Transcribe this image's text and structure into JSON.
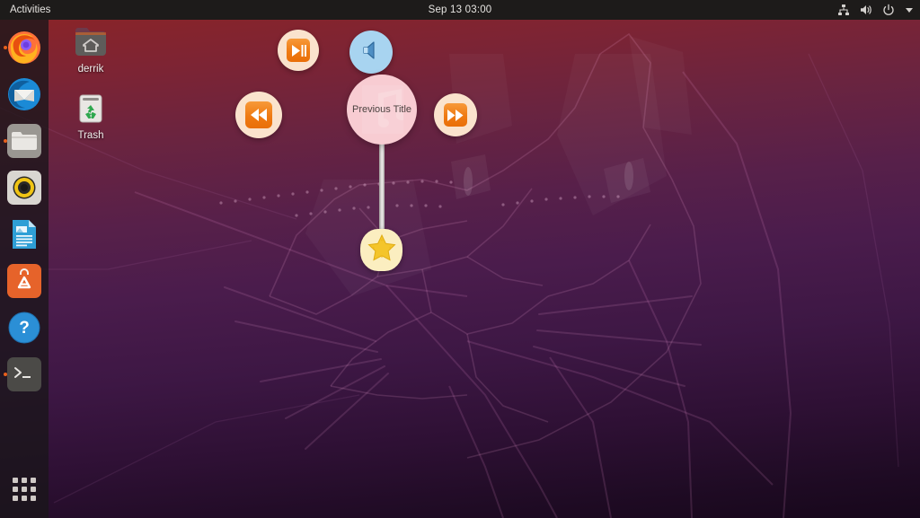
{
  "topbar": {
    "activities_label": "Activities",
    "clock": "Sep 13  03:00",
    "status_icons": [
      {
        "name": "network-sharing-icon",
        "glyph": "network"
      },
      {
        "name": "volume-icon",
        "glyph": "volume"
      },
      {
        "name": "power-icon",
        "glyph": "power"
      },
      {
        "name": "chevron-down-icon",
        "glyph": "chevron"
      }
    ]
  },
  "dock": {
    "items": [
      {
        "label": "Firefox Web Browser",
        "icon": "firefox-icon",
        "running": true
      },
      {
        "label": "Thunderbird Mail",
        "icon": "thunderbird-icon",
        "running": false
      },
      {
        "label": "Files",
        "icon": "files-icon",
        "running": true
      },
      {
        "label": "Rhythmbox",
        "icon": "rhythmbox-icon",
        "running": false
      },
      {
        "label": "LibreOffice Writer",
        "icon": "libreoffice-writer-icon",
        "running": false
      },
      {
        "label": "Ubuntu Software",
        "icon": "ubuntu-software-icon",
        "running": false
      },
      {
        "label": "Help",
        "icon": "help-icon",
        "running": false
      },
      {
        "label": "Terminal",
        "icon": "terminal-icon",
        "running": true
      }
    ],
    "show_applications_label": "Show Applications"
  },
  "desktop": {
    "icons": [
      {
        "label": "derrik",
        "icon": "home-folder-icon"
      },
      {
        "label": "Trash",
        "icon": "trash-icon"
      }
    ]
  },
  "music_widget": {
    "track_title": "Previous Title",
    "album_art_icon": "music-note-icon",
    "buttons": [
      {
        "name": "play-pause-button",
        "icon": "play-pause-icon",
        "color": "#ef7a12"
      },
      {
        "name": "volume-button",
        "icon": "speaker-icon",
        "color": "#a8d4f0"
      },
      {
        "name": "previous-button",
        "icon": "rewind-icon",
        "color": "#ef7a12"
      },
      {
        "name": "next-button",
        "icon": "fast-forward-icon",
        "color": "#ef7a12"
      },
      {
        "name": "favorite-button",
        "icon": "star-icon",
        "color": "#f2c42a"
      }
    ]
  },
  "colors": {
    "panel": "#1d1b1a",
    "accent_orange": "#e8601c",
    "widget_disc": "#f8ccd2",
    "wallpaper_top": "#8d2425",
    "wallpaper_bottom": "#17071b"
  }
}
